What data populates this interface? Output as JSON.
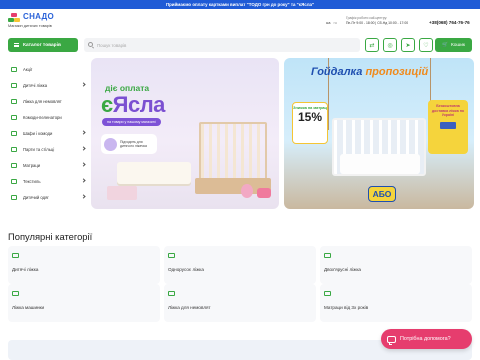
{
  "topbar": {
    "text": "Приймаємо оплату картками виплат \"ТОДО грн до року\" та \"єЯсла\""
  },
  "header": {
    "logo_word": "СНАДО",
    "logo_tagline": "Магазин дитячих товарів",
    "lang_ua": "ua",
    "lang_ru": "ru",
    "hours_title": "Графік роботи call-центру:",
    "hours_text": "Пн-Пт 9:00 - 18:00 | Сб-Нд 10:00 - 17:00",
    "phone": "+38(068) 764-76-76"
  },
  "navbar": {
    "catalog_label": "Каталог товарів",
    "search_placeholder": "Пошук товарів",
    "cart_label": "Кошик"
  },
  "sidebar": {
    "items": [
      {
        "label": "Акції"
      },
      {
        "label": "Дитячі ліжка"
      },
      {
        "label": "Ліжка для немовлят"
      },
      {
        "label": "Комоди-пеленатори"
      },
      {
        "label": "Шафи і комоди"
      },
      {
        "label": "Парти та стільці"
      },
      {
        "label": "Матраци"
      },
      {
        "label": "Текстиль"
      },
      {
        "label": "Дитячий одяг"
      }
    ]
  },
  "banner1": {
    "line1": "діє оплата",
    "line2_a": "є",
    "line2_b": "Ясла",
    "pill": "на товари у нашому магазині",
    "badge_text": "Підходить для дитячого ліжечка"
  },
  "banner2": {
    "title_a": "Гойдалка",
    "title_b": "пропозицій",
    "discount_text": "Знижка на матрац",
    "discount_value": "15%",
    "delivery_text": "Безкоштовна доставка ліжка по Україні",
    "abo": "АБО"
  },
  "categories": {
    "title": "Популярні категорії",
    "items": [
      {
        "label": "Дитячі ліжка"
      },
      {
        "label": "Однорусоє ліжка"
      },
      {
        "label": "Двох'ярусні ліжка"
      },
      {
        "label": "Ліжка машинки"
      },
      {
        "label": "Ліжка для немовлят"
      },
      {
        "label": "Матраци від 3х років"
      }
    ]
  },
  "help": {
    "label": "Потрібна допомога?"
  },
  "colors": {
    "brand_green": "#3aa843",
    "top_blue": "#1f5bd6",
    "help_pink": "#e63d6e"
  }
}
